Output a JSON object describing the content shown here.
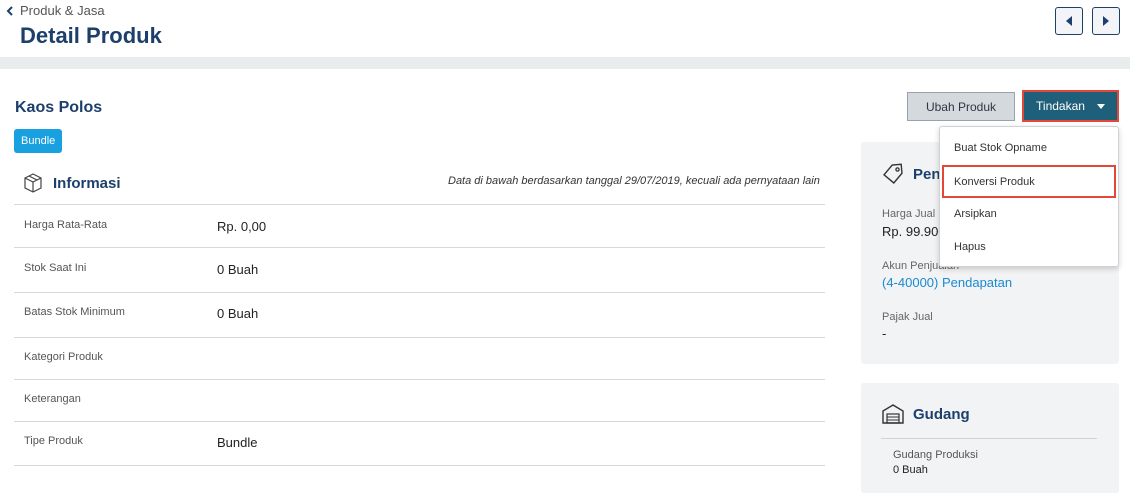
{
  "header": {
    "breadcrumb": "Produk & Jasa",
    "title": "Detail Produk"
  },
  "product": {
    "name": "Kaos Polos",
    "badge": "Bundle"
  },
  "actions": {
    "edit_label": "Ubah Produk",
    "action_label": "Tindakan",
    "menu": [
      "Buat Stok Opname",
      "Konversi Produk",
      "Arsipkan",
      "Hapus"
    ]
  },
  "info": {
    "title": "Informasi",
    "note": "Data di bawah berdasarkan tanggal 29/07/2019, kecuali ada pernyataan lain",
    "rows": [
      {
        "label": "Harga Rata-Rata",
        "value": "Rp. 0,00"
      },
      {
        "label": "Stok Saat Ini",
        "value": "0 Buah"
      },
      {
        "label": "Batas Stok Minimum",
        "value": "0 Buah"
      },
      {
        "label": "Kategori Produk",
        "value": ""
      },
      {
        "label": "Keterangan",
        "value": ""
      },
      {
        "label": "Tipe Produk",
        "value": "Bundle"
      }
    ]
  },
  "sales_card": {
    "title": "Penj",
    "price_label": "Harga Jual S",
    "price_value": "Rp. 99.900",
    "account_label": "Akun Penjualan",
    "account_value": "(4-40000) Pendapatan",
    "tax_label": "Pajak Jual",
    "tax_value": "-"
  },
  "warehouse_card": {
    "title": "Gudang",
    "name": "Gudang Produksi",
    "stock": "0 Buah"
  },
  "icons": {
    "back": "chevron-left-icon",
    "prev": "caret-left-icon",
    "next": "caret-right-icon",
    "info": "box-icon",
    "sales": "tag-icon",
    "warehouse": "warehouse-icon"
  },
  "colors": {
    "title": "#1d3f6b",
    "primary_button": "#1f5f7a",
    "badge": "#18a0e0",
    "link": "#1a8ad0",
    "highlight": "#e2473a"
  }
}
